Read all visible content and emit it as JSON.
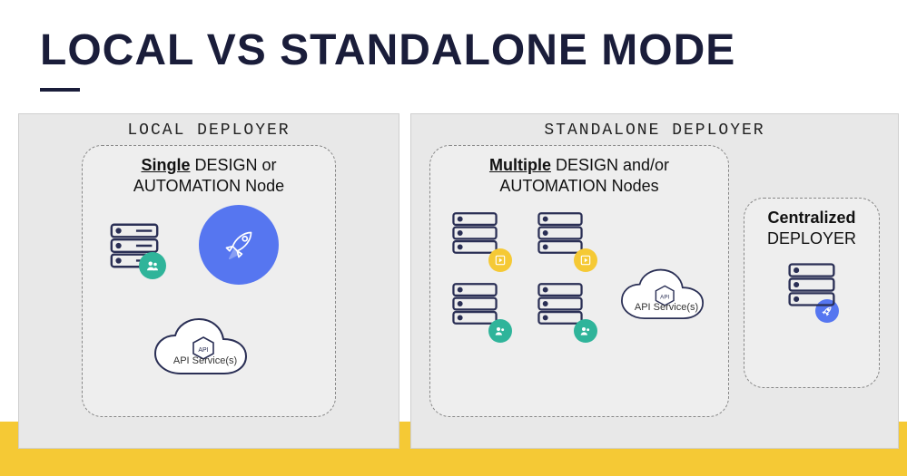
{
  "title": "LOCAL VS STANDALONE MODE",
  "panels": {
    "local": {
      "title": "LOCAL DEPLOYER",
      "box": {
        "caption_underlined": "Single",
        "caption_rest_line1": " DESIGN or",
        "caption_line2": "AUTOMATION Node",
        "api_label": "API Service(s)"
      }
    },
    "standalone": {
      "title": "STANDALONE DEPLOYER",
      "main_box": {
        "caption_underlined": "Multiple",
        "caption_rest_line1": " DESIGN and/or",
        "caption_line2": "AUTOMATION Nodes",
        "api_label": "API Service(s)"
      },
      "side_box": {
        "caption_line1": "Centralized",
        "caption_line2": "DEPLOYER"
      }
    }
  },
  "colors": {
    "accent_blue": "#5676f0",
    "accent_teal": "#2fb49a",
    "accent_yellow": "#f5c935",
    "heading": "#1a1d3a"
  },
  "icons": {
    "server": "server-icon",
    "rocket": "rocket-icon",
    "cloud": "cloud-icon",
    "api_hex": "api-hex-icon",
    "people": "people-icon",
    "play": "play-icon"
  }
}
